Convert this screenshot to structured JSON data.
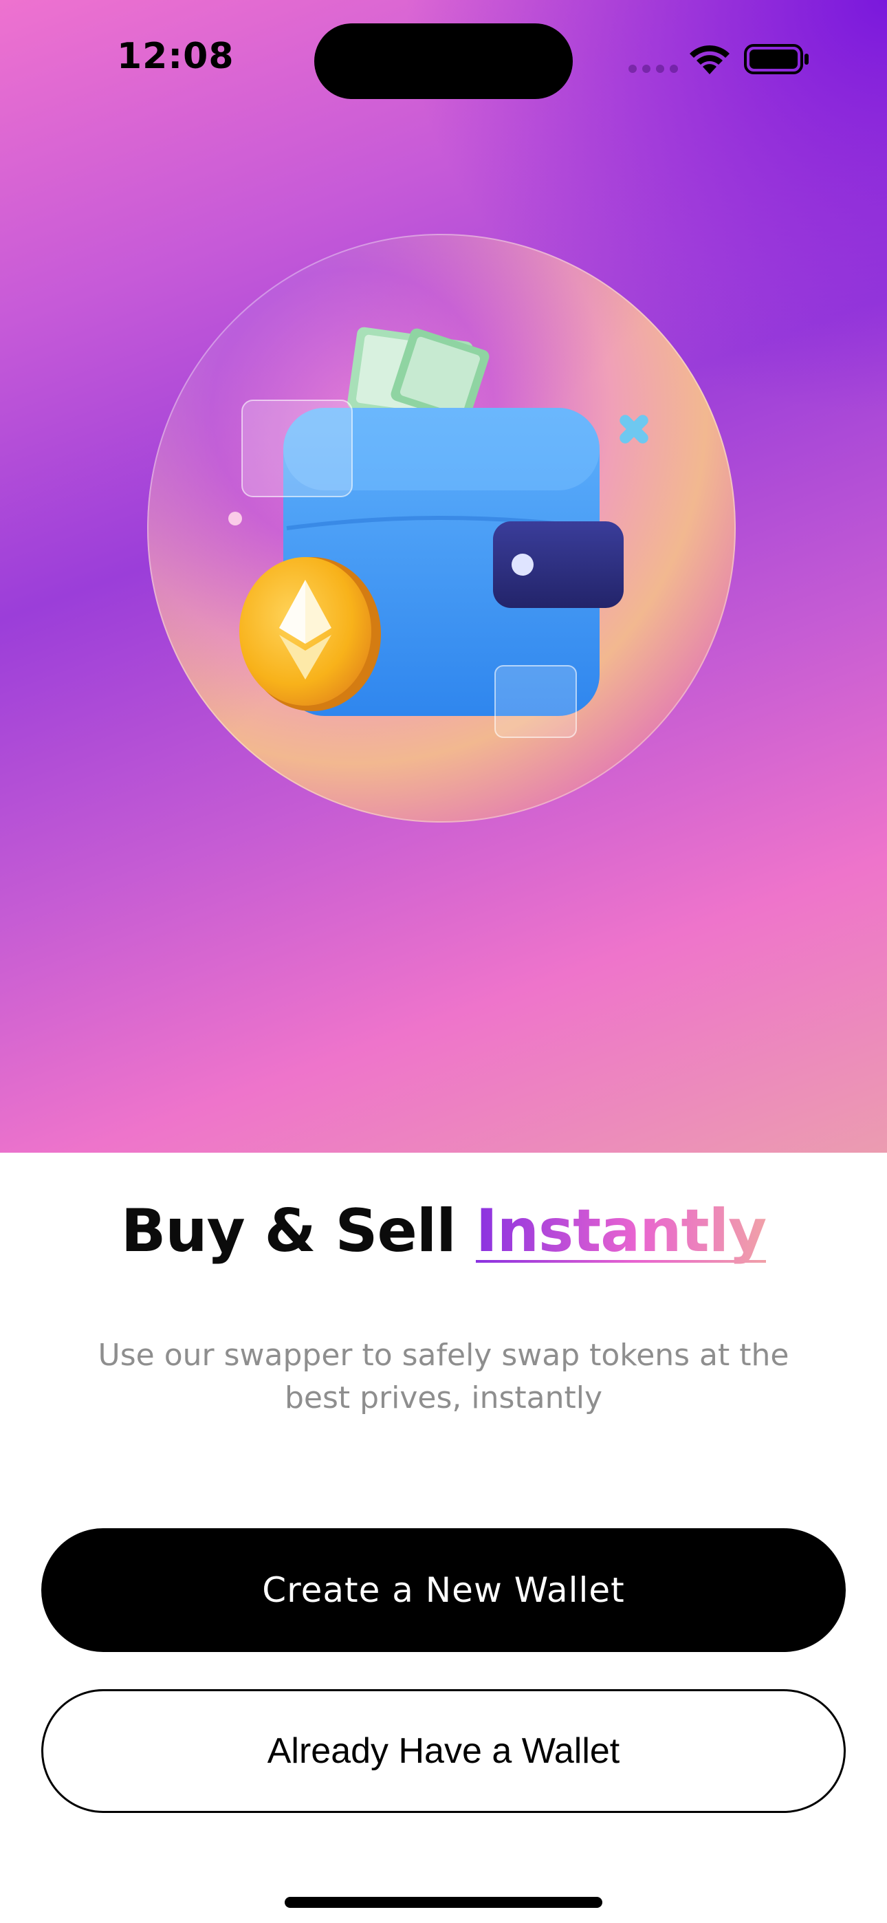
{
  "status_bar": {
    "time": "12:08"
  },
  "onboarding": {
    "title_main": "Buy & Sell",
    "title_accent": "Instantly",
    "subtitle": "Use our swapper to safely swap tokens at the best prives, instantly"
  },
  "actions": {
    "create_label": "Create a New Wallet",
    "existing_label": "Already Have a Wallet"
  },
  "colors": {
    "accent_start": "#8a32e0",
    "accent_mid": "#e864d0",
    "accent_end": "#f0a0a8",
    "primary_button": "#000000"
  },
  "icons": [
    "wifi-icon",
    "battery-icon",
    "wallet-illustration",
    "ethereum-coin-icon"
  ]
}
